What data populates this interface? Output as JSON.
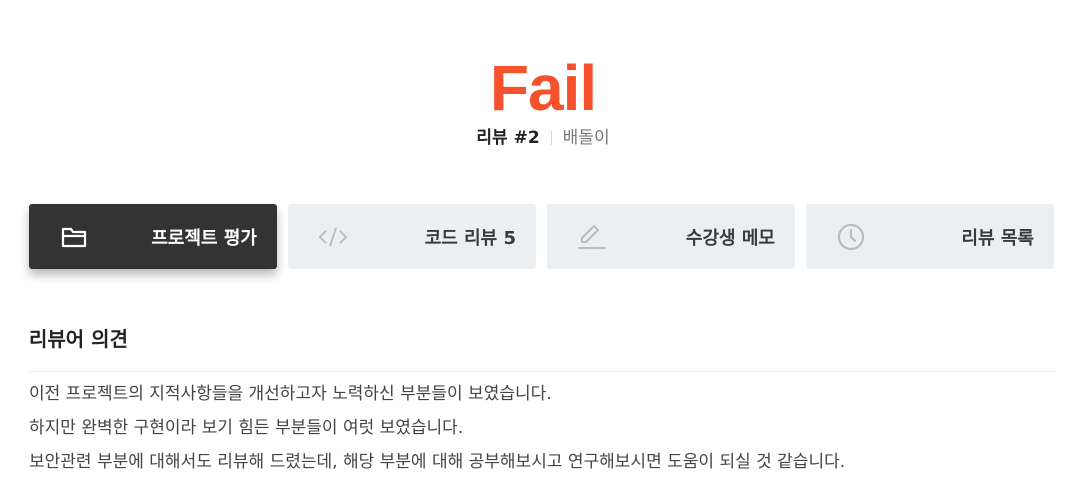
{
  "result": {
    "label": "Fail",
    "color": "#f4512c"
  },
  "review": {
    "number": "리뷰 #2",
    "reviewer": "배돌이"
  },
  "tabs": [
    {
      "label": "프로젝트 평가",
      "icon": "folder-icon",
      "active": true
    },
    {
      "label": "코드 리뷰 5",
      "icon": "code-icon",
      "active": false
    },
    {
      "label": "수강생 메모",
      "icon": "pencil-icon",
      "active": false
    },
    {
      "label": "리뷰 목록",
      "icon": "clock-icon",
      "active": false
    }
  ],
  "opinion": {
    "title": "리뷰어 의견",
    "lines": [
      "이전 프로젝트의 지적사항들을 개선하고자 노력하신 부분들이 보였습니다.",
      "하지만 완벽한 구현이라 보기 힘든 부분들이 여럿 보였습니다.",
      "보안관련 부분에 대해서도 리뷰해 드렸는데, 해당 부분에 대해 공부해보시고 연구해보시면 도움이 되실 것 같습니다."
    ]
  }
}
